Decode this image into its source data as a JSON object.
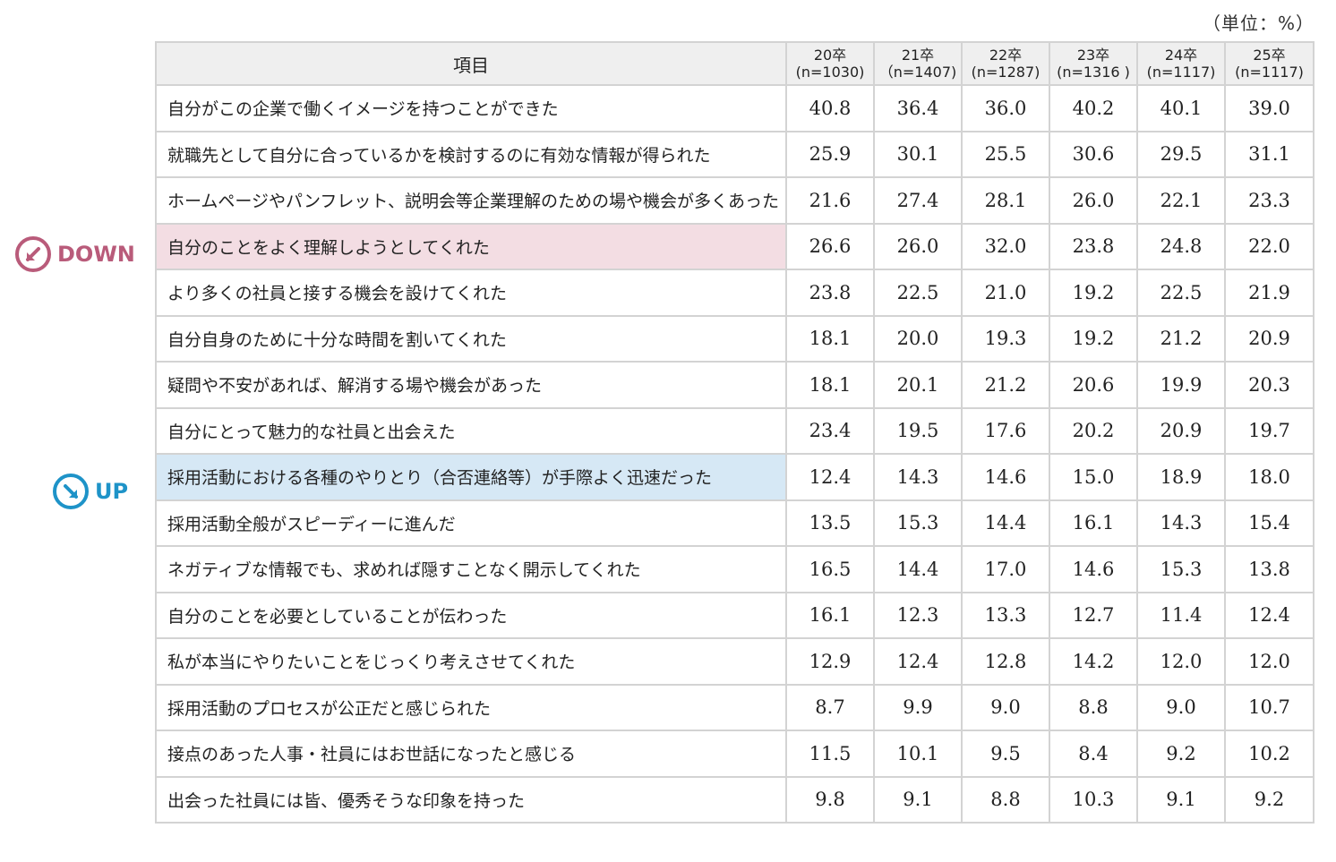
{
  "unit_label": "（単位：%）",
  "markers": {
    "down_label": "DOWN",
    "up_label": "UP",
    "down_color": "#b95b7a",
    "up_color": "#1e93c8"
  },
  "chart_data": {
    "type": "table",
    "item_header": "項目",
    "columns": [
      {
        "year": "20卒",
        "n": "(n=1030)"
      },
      {
        "year": "21卒",
        "n": "（n=1407)"
      },
      {
        "year": "22卒",
        "n": "(n=1287)"
      },
      {
        "year": "23卒",
        "n": "(n=1316 )"
      },
      {
        "year": "24卒",
        "n": "(n=1117)"
      },
      {
        "year": "25卒",
        "n": "(n=1117)"
      }
    ],
    "rows": [
      {
        "item": "自分がこの企業で働くイメージを持つことができた",
        "values": [
          "40.8",
          "36.4",
          "36.0",
          "40.2",
          "40.1",
          "39.0"
        ]
      },
      {
        "item": "就職先として自分に合っているかを検討するのに有効な情報が得られた",
        "values": [
          "25.9",
          "30.1",
          "25.5",
          "30.6",
          "29.5",
          "31.1"
        ]
      },
      {
        "item": "ホームページやパンフレット、説明会等企業理解のための場や機会が多くあった",
        "values": [
          "21.6",
          "27.4",
          "28.1",
          "26.0",
          "22.1",
          "23.3"
        ]
      },
      {
        "item": "自分のことをよく理解しようとしてくれた",
        "values": [
          "26.6",
          "26.0",
          "32.0",
          "23.8",
          "24.8",
          "22.0"
        ],
        "highlight": "down"
      },
      {
        "item": "より多くの社員と接する機会を設けてくれた",
        "values": [
          "23.8",
          "22.5",
          "21.0",
          "19.2",
          "22.5",
          "21.9"
        ]
      },
      {
        "item": "自分自身のために十分な時間を割いてくれた",
        "values": [
          "18.1",
          "20.0",
          "19.3",
          "19.2",
          "21.2",
          "20.9"
        ]
      },
      {
        "item": "疑問や不安があれば、解消する場や機会があった",
        "values": [
          "18.1",
          "20.1",
          "21.2",
          "20.6",
          "19.9",
          "20.3"
        ]
      },
      {
        "item": "自分にとって魅力的な社員と出会えた",
        "values": [
          "23.4",
          "19.5",
          "17.6",
          "20.2",
          "20.9",
          "19.7"
        ]
      },
      {
        "item": "採用活動における各種のやりとり（合否連絡等）が手際よく迅速だった",
        "values": [
          "12.4",
          "14.3",
          "14.6",
          "15.0",
          "18.9",
          "18.0"
        ],
        "highlight": "up"
      },
      {
        "item": "採用活動全般がスピーディーに進んだ",
        "values": [
          "13.5",
          "15.3",
          "14.4",
          "16.1",
          "14.3",
          "15.4"
        ]
      },
      {
        "item": "ネガティブな情報でも、求めれば隠すことなく開示してくれた",
        "values": [
          "16.5",
          "14.4",
          "17.0",
          "14.6",
          "15.3",
          "13.8"
        ]
      },
      {
        "item": "自分のことを必要としていることが伝わった",
        "values": [
          "16.1",
          "12.3",
          "13.3",
          "12.7",
          "11.4",
          "12.4"
        ]
      },
      {
        "item": "私が本当にやりたいことをじっくり考えさせてくれた",
        "values": [
          "12.9",
          "12.4",
          "12.8",
          "14.2",
          "12.0",
          "12.0"
        ]
      },
      {
        "item": "採用活動のプロセスが公正だと感じられた",
        "values": [
          "8.7",
          "9.9",
          "9.0",
          "8.8",
          "9.0",
          "10.7"
        ]
      },
      {
        "item": "接点のあった人事・社員にはお世話になったと感じる",
        "values": [
          "11.5",
          "10.1",
          "9.5",
          "8.4",
          "9.2",
          "10.2"
        ]
      },
      {
        "item": "出会った社員には皆、優秀そうな印象を持った",
        "values": [
          "9.8",
          "9.1",
          "8.8",
          "10.3",
          "9.1",
          "9.2"
        ]
      }
    ]
  }
}
